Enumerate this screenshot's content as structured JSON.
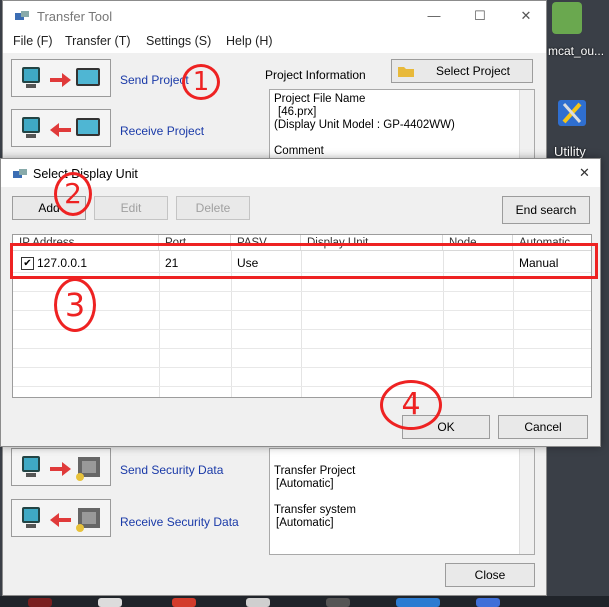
{
  "main_window": {
    "title": "Transfer Tool",
    "controls": {
      "minimize": "—",
      "maximize": "☐",
      "close": "✕"
    }
  },
  "menu": [
    "File (F)",
    "Transfer (T)",
    "Settings (S)",
    "Help (H)"
  ],
  "actions": {
    "send_project": "Send Project",
    "receive_project": "Receive Project",
    "send_security": "Send Security Data",
    "receive_security": "Receive Security Data"
  },
  "project_info": {
    "label": "Project Information",
    "select_button": "Select Project",
    "lines": [
      "Project File Name",
      "[46.prx]",
      "(Display Unit Model : GP-4402WW)",
      "",
      "Comment"
    ]
  },
  "transfer_settings": {
    "lines": [
      "Transfer Project",
      "[Automatic]",
      "",
      "Transfer system",
      "[Automatic]"
    ]
  },
  "close_button": "Close",
  "dialog": {
    "title": "Select Display Unit",
    "buttons": {
      "add": "Add",
      "edit": "Edit",
      "delete": "Delete",
      "end_search": "End search",
      "ok": "OK",
      "cancel": "Cancel"
    },
    "close": "✕",
    "columns": [
      "IP Address",
      "Port",
      "PASV",
      "Display Unit",
      "Node",
      "Automatic..."
    ],
    "rows": [
      {
        "checked": true,
        "ip": "127.0.0.1",
        "port": "21",
        "pasv": "Use",
        "display_unit": "",
        "node": "",
        "automatic": "Manual"
      }
    ]
  },
  "annotations": [
    "1",
    "2",
    "3",
    "4"
  ],
  "desktop": {
    "icon_label_top": "mcat_ou...",
    "icon_label_utility": "Utility"
  },
  "colors": {
    "annotation_red": "#ee2222",
    "link_blue": "#1a3aa8",
    "window_bg": "#f0f0f0"
  }
}
